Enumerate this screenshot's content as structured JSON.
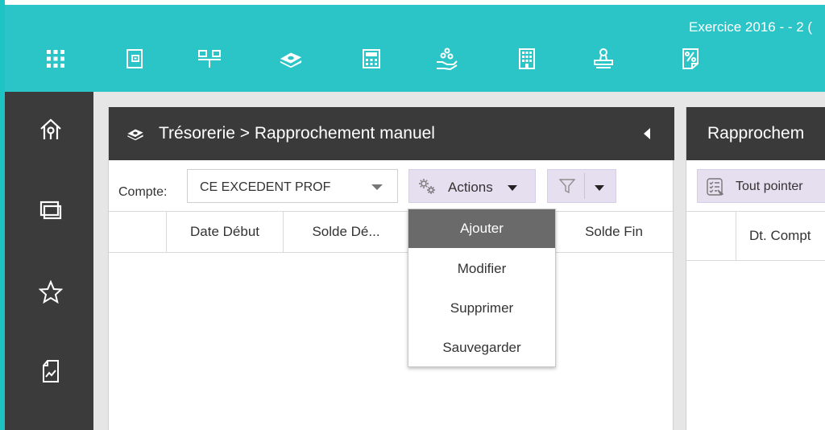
{
  "topbar": {
    "exercise_text": "Exercice 2016 - - 2 (",
    "icons": [
      "apps-grid-icon",
      "wallet-icon",
      "org-chart-icon",
      "money-stack-icon",
      "calculator-icon",
      "hand-coins-icon",
      "building-icon",
      "stamp-icon",
      "percent-document-icon"
    ]
  },
  "sidebar": {
    "icons": [
      "home-icon",
      "windows-icon",
      "star-icon",
      "report-chart-icon"
    ]
  },
  "left_panel": {
    "title": "Trésorerie > Rapprochement manuel",
    "compte_label": "Compte:",
    "compte_value": "CE EXCEDENT PROF",
    "actions_label": "Actions",
    "columns": [
      "",
      "Date Début",
      "Solde Dé...",
      "",
      "Solde Fin"
    ]
  },
  "actions_menu": {
    "items": [
      "Ajouter",
      "Modifier",
      "Supprimer",
      "Sauvegarder"
    ],
    "active": "Ajouter"
  },
  "right_panel": {
    "title": "Rapprochem",
    "tout_pointer_label": "Tout pointer",
    "column": "Dt. Compt"
  },
  "colors": {
    "topbar": "#2bc5c8",
    "sidebar": "#3b3b3b",
    "panel_header": "#3a3a3a",
    "button_bg": "#e6dff0",
    "menu_active": "#6a6a6a"
  }
}
